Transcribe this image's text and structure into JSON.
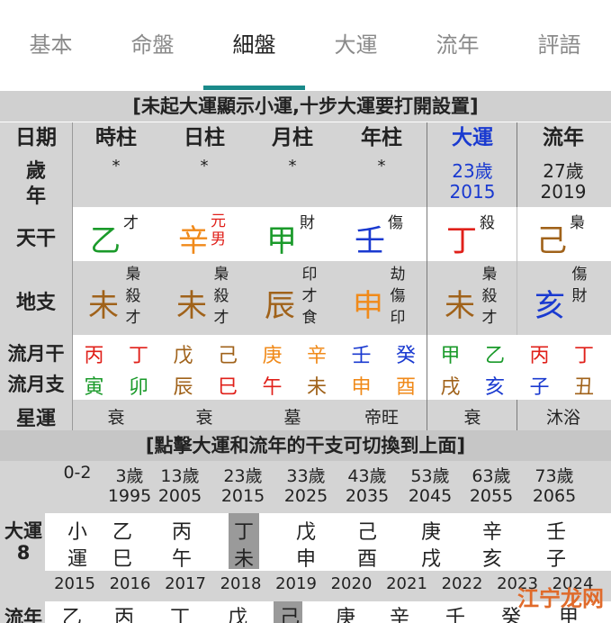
{
  "tabs": [
    "基本",
    "命盤",
    "細盤",
    "大運",
    "流年",
    "評語"
  ],
  "banner_top": "[未起大運顯示小運,十步大運要打開設置]",
  "header": [
    "日期",
    "時柱",
    "日柱",
    "月柱",
    "年柱",
    "大運",
    "流年"
  ],
  "age_label_1": "歲",
  "age_label_2": "年",
  "stars": [
    "*",
    "*",
    "*",
    "*"
  ],
  "dayun_age": "23歲",
  "dayun_year": "2015",
  "liunian_age": "27歲",
  "liunian_year": "2019",
  "tiangan_label": "天干",
  "tiangan": [
    {
      "char": "乙",
      "note": "才",
      "color": "#1a9a2a"
    },
    {
      "char": "辛",
      "note": "元男",
      "color": "#f08a1a"
    },
    {
      "char": "甲",
      "note": "財",
      "color": "#1a9a2a"
    },
    {
      "char": "壬",
      "note": "傷",
      "color": "#1a3ad0"
    },
    {
      "char": "丁",
      "note": "殺",
      "color": "#e0201a"
    },
    {
      "char": "己",
      "note": "梟",
      "color": "#a0621a"
    }
  ],
  "dizhi_label": "地支",
  "dizhi": [
    {
      "char": "未",
      "hidden": [
        "梟",
        "殺",
        "才"
      ],
      "color": "#a0621a"
    },
    {
      "char": "未",
      "hidden": [
        "梟",
        "殺",
        "才"
      ],
      "color": "#a0621a"
    },
    {
      "char": "辰",
      "hidden": [
        "印",
        "才",
        "食"
      ],
      "color": "#a0621a"
    },
    {
      "char": "申",
      "hidden": [
        "劫",
        "傷",
        "印"
      ],
      "color": "#f08a1a"
    },
    {
      "char": "未",
      "hidden": [
        "梟",
        "殺",
        "才"
      ],
      "color": "#a0621a"
    },
    {
      "char": "亥",
      "hidden": [
        "傷",
        "財"
      ],
      "color": "#1a3ad0"
    }
  ],
  "flow_gan_label": "流月干",
  "flow_gan": [
    {
      "c": "丙",
      "color": "#e0201a"
    },
    {
      "c": "丁",
      "color": "#e0201a"
    },
    {
      "c": "戊",
      "color": "#a0621a"
    },
    {
      "c": "己",
      "color": "#a0621a"
    },
    {
      "c": "庚",
      "color": "#f08a1a"
    },
    {
      "c": "辛",
      "color": "#f08a1a"
    },
    {
      "c": "壬",
      "color": "#1a3ad0"
    },
    {
      "c": "癸",
      "color": "#1a3ad0"
    },
    {
      "c": "甲",
      "color": "#1a9a2a"
    },
    {
      "c": "乙",
      "color": "#1a9a2a"
    },
    {
      "c": "丙",
      "color": "#e0201a"
    },
    {
      "c": "丁",
      "color": "#e0201a"
    }
  ],
  "flow_zhi_label": "流月支",
  "flow_zhi": [
    {
      "c": "寅",
      "color": "#1a9a2a"
    },
    {
      "c": "卯",
      "color": "#1a9a2a"
    },
    {
      "c": "辰",
      "color": "#a0621a"
    },
    {
      "c": "巳",
      "color": "#e0201a"
    },
    {
      "c": "午",
      "color": "#e0201a"
    },
    {
      "c": "未",
      "color": "#a0621a"
    },
    {
      "c": "申",
      "color": "#f08a1a"
    },
    {
      "c": "酉",
      "color": "#f08a1a"
    },
    {
      "c": "戌",
      "color": "#a0621a"
    },
    {
      "c": "亥",
      "color": "#1a3ad0"
    },
    {
      "c": "子",
      "color": "#1a3ad0"
    },
    {
      "c": "丑",
      "color": "#a0621a"
    }
  ],
  "xingyun_label": "星運",
  "xingyun": [
    "衰",
    "衰",
    "墓",
    "帝旺",
    "衰",
    "沐浴"
  ],
  "banner_mid": "[點擊大運和流年的干支可切換到上面]",
  "dayun_ages": [
    "0-2",
    "3歲",
    "13歲",
    "23歲",
    "33歲",
    "43歲",
    "53歲",
    "63歲",
    "73歲"
  ],
  "dayun_years": [
    "",
    "1995",
    "2005",
    "2015",
    "2025",
    "2035",
    "2045",
    "2055",
    "2065"
  ],
  "dayun_label": "大運",
  "dayun_num": "8",
  "dayun_top": [
    "小",
    "乙",
    "丙",
    "丁",
    "戊",
    "己",
    "庚",
    "辛",
    "壬"
  ],
  "dayun_bot": [
    "運",
    "巳",
    "午",
    "未",
    "申",
    "酉",
    "戌",
    "亥",
    "子"
  ],
  "liunian_years": [
    "2015",
    "2016",
    "2017",
    "2018",
    "2019",
    "2020",
    "2021",
    "2022",
    "2023",
    "2024"
  ],
  "liunian_label": "流年",
  "liunian_top": [
    "乙",
    "丙",
    "丁",
    "戊",
    "己",
    "庚",
    "辛",
    "壬",
    "癸",
    "甲"
  ],
  "watermark": "江宁龙网",
  "colors": {
    "accent": "#1a8a8a",
    "header_blue": "#1a3ad0",
    "band_gray": "#d4d4d4"
  }
}
